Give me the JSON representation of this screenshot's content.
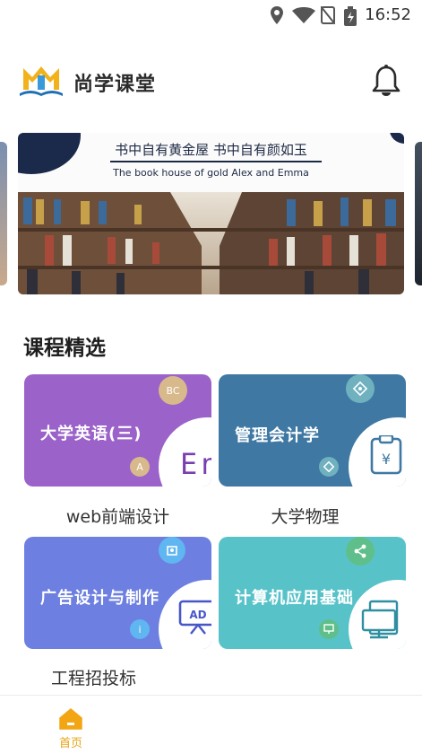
{
  "status_bar": {
    "time": "16:52"
  },
  "header": {
    "app_title": "尚学课堂"
  },
  "banner": {
    "title_cn": "书中自有黄金屋   书中自有颜如玉",
    "subtitle_en": "The book house of gold Alex and Emma"
  },
  "section": {
    "title": "课程精选"
  },
  "courses": [
    {
      "card_text": "大学英语(三)",
      "badge_top": "BC",
      "badge_bottom": "A",
      "icon_text": "En",
      "caption": "web前端设计",
      "color": "#9b62c9"
    },
    {
      "card_text": "管理会计学",
      "badge_top": "",
      "badge_bottom": "",
      "icon_text": "¥",
      "caption": "大学物理",
      "color": "#3f78a3"
    },
    {
      "card_text": "广告设计与制作",
      "badge_top": "",
      "badge_bottom": "",
      "icon_text": "AD",
      "caption": "工程招投标",
      "color": "#6d7fe0"
    },
    {
      "card_text": "计算机应用基础",
      "badge_top": "",
      "badge_bottom": "",
      "icon_text": "",
      "caption": "",
      "color": "#58c2c9"
    }
  ],
  "bottom_nav": {
    "home_label": "首页",
    "active_color": "#e7a411"
  }
}
